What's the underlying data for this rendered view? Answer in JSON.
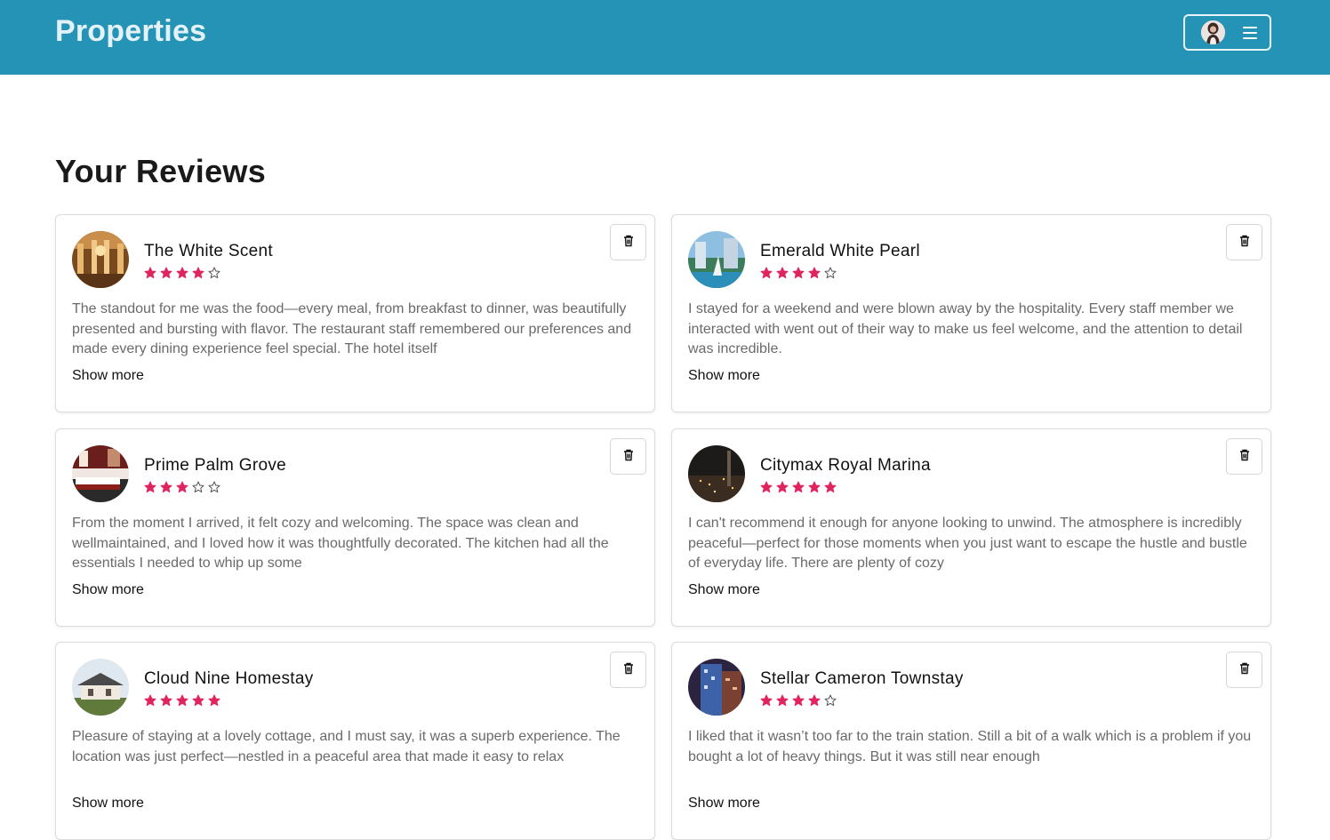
{
  "header": {
    "brand": "Properties",
    "accent_color": "#2593b5",
    "menu_icons": [
      "user-avatar",
      "hamburger-icon"
    ]
  },
  "main": {
    "title": "Your Reviews",
    "show_more_label": "Show more",
    "star_color": "#e0245e",
    "reviews": [
      {
        "name": "The White Scent",
        "rating": 4,
        "text": "The standout for me was the food—every meal, from breakfast to dinner, was beautifully presented and bursting with flavor. The restaurant staff remembered our preferences and made every dining experience feel special. The hotel itself"
      },
      {
        "name": "Emerald White Pearl",
        "rating": 4,
        "text": "I stayed for a weekend and were blown away by the hospitality. Every staff member we interacted with went out of their way to make us feel welcome, and the attention to detail was incredible."
      },
      {
        "name": "Prime Palm Grove",
        "rating": 3,
        "text": "From the moment I arrived, it felt cozy and welcoming. The space was clean and wellmaintained, and I loved how it was thoughtfully decorated. The kitchen had all the essentials I needed to whip up some"
      },
      {
        "name": "Citymax Royal Marina",
        "rating": 5,
        "text": "I can't recommend it enough for anyone looking to unwind. The atmosphere is incredibly peaceful—perfect for those moments when you just want to escape the hustle and bustle of everyday life. There are plenty of cozy"
      },
      {
        "name": "Cloud Nine Homestay",
        "rating": 5,
        "text": "Pleasure of staying at a lovely cottage, and I must say, it was a superb experience. The location was just perfect—nestled in a peaceful area that made it easy to relax"
      },
      {
        "name": "Stellar Cameron Townstay",
        "rating": 4,
        "text": "I liked that it wasn’t too far to the train station. Still a bit of a walk which is a problem if you bought a lot of heavy things. But it was still near enough"
      }
    ]
  }
}
